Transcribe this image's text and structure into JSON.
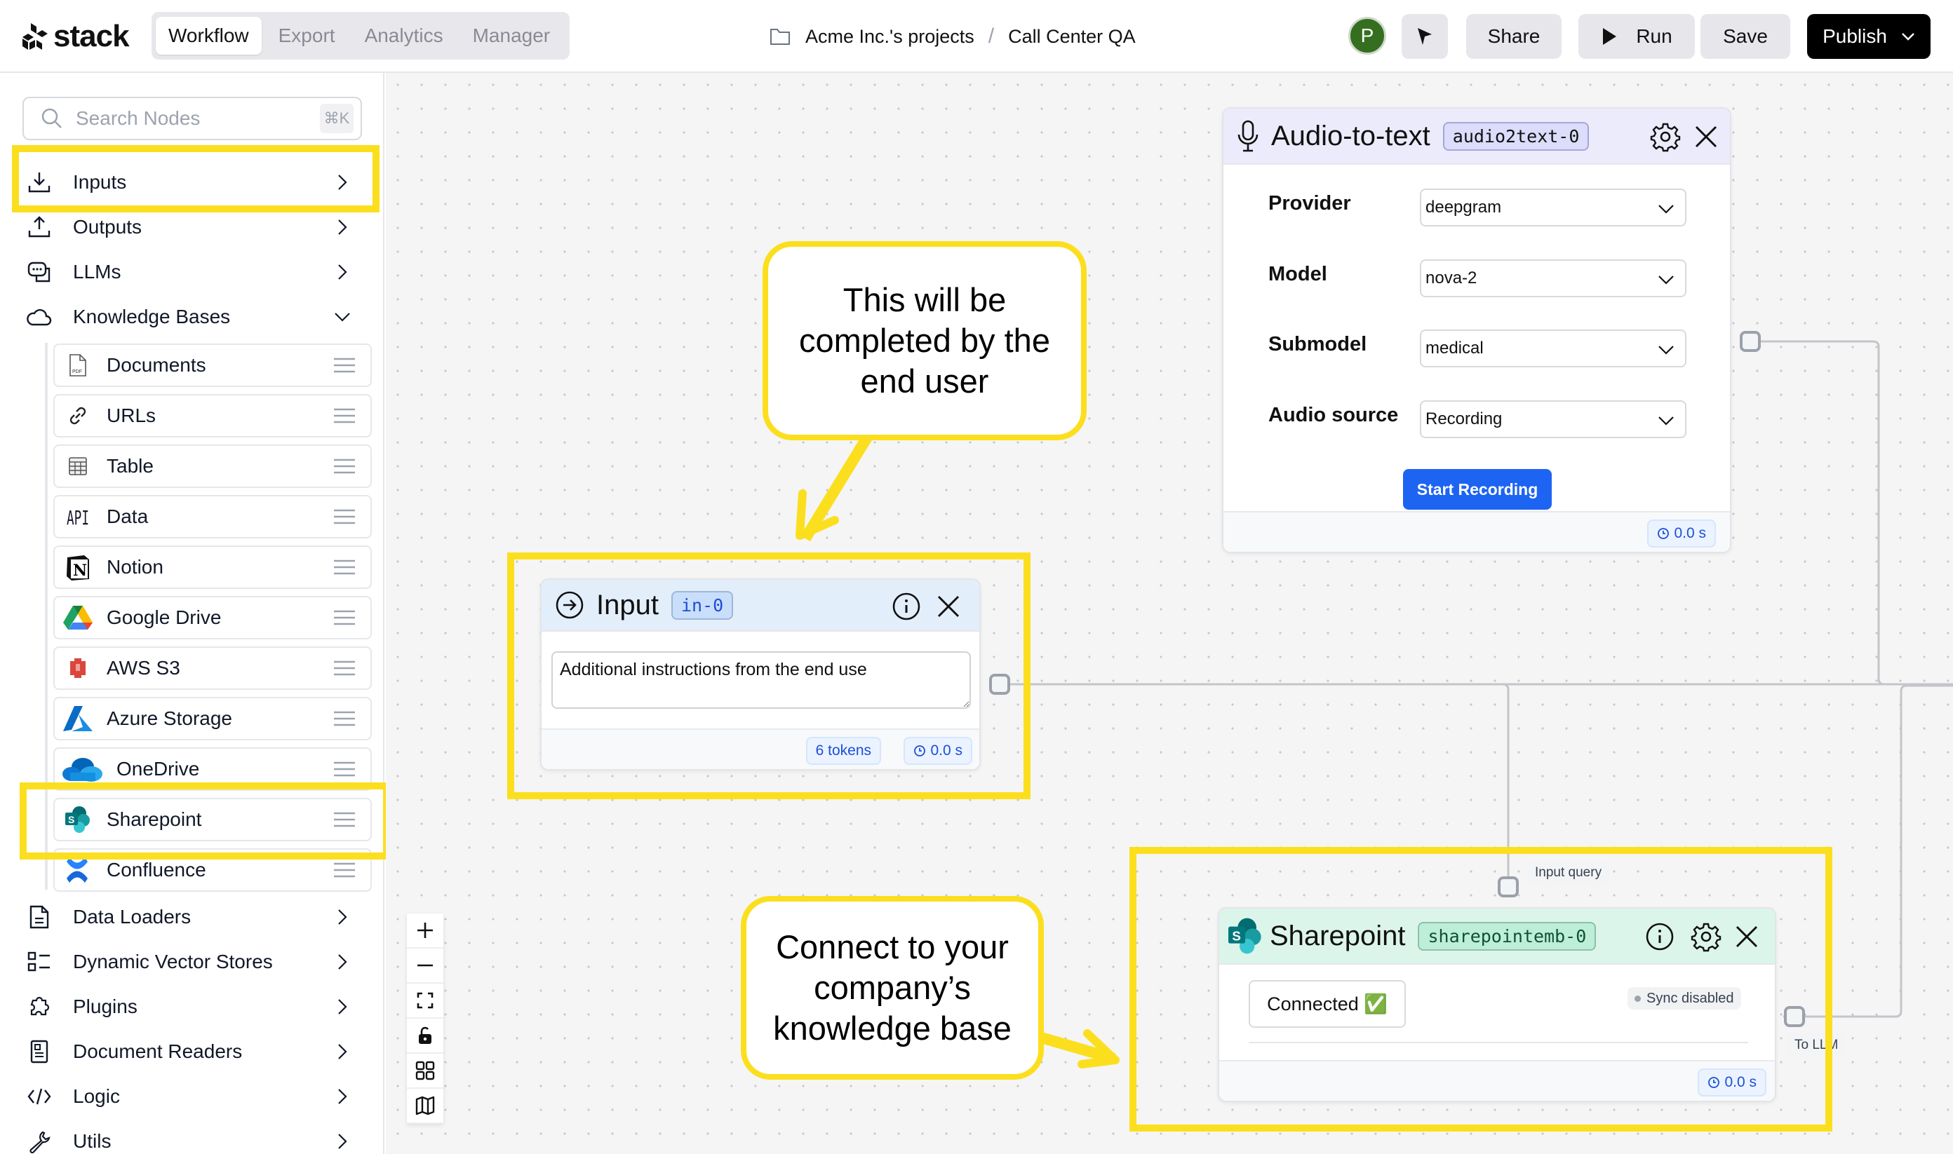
{
  "app": {
    "logo_text": "stack",
    "tabs": [
      {
        "label": "Workflow",
        "active": true
      },
      {
        "label": "Export",
        "active": false
      },
      {
        "label": "Analytics",
        "active": false
      },
      {
        "label": "Manager",
        "active": false
      }
    ],
    "breadcrumb": {
      "project": "Acme Inc.'s projects",
      "separator": "/",
      "flow": "Call Center QA"
    },
    "user_initial": "P",
    "buttons": {
      "share": "Share",
      "run": "Run",
      "save": "Save",
      "publish": "Publish"
    },
    "colors": {
      "avatar": "#356e1f",
      "highlight": "#fbdf1e",
      "primary_button": "#1d64f2"
    }
  },
  "sidebar": {
    "search_placeholder": "Search Nodes",
    "search_shortcut": "⌘K",
    "categories_top": [
      {
        "label": "Inputs",
        "icon": "download-icon",
        "expanded": false
      },
      {
        "label": "Outputs",
        "icon": "upload-icon",
        "expanded": false
      },
      {
        "label": "LLMs",
        "icon": "chat-bubbles-icon",
        "expanded": false
      },
      {
        "label": "Knowledge Bases",
        "icon": "cloud-icon",
        "expanded": true
      }
    ],
    "knowledge_bases": [
      {
        "label": "Documents",
        "icon": "pdf-file-icon"
      },
      {
        "label": "URLs",
        "icon": "link-icon"
      },
      {
        "label": "Table",
        "icon": "table-icon"
      },
      {
        "label": "Data",
        "icon": "api-icon"
      },
      {
        "label": "Notion",
        "icon": "notion-icon"
      },
      {
        "label": "Google Drive",
        "icon": "google-drive-icon"
      },
      {
        "label": "AWS S3",
        "icon": "aws-s3-icon"
      },
      {
        "label": "Azure Storage",
        "icon": "azure-icon"
      },
      {
        "label": "OneDrive",
        "icon": "onedrive-icon"
      },
      {
        "label": "Sharepoint",
        "icon": "sharepoint-icon"
      },
      {
        "label": "Confluence",
        "icon": "confluence-icon"
      }
    ],
    "categories_bottom": [
      {
        "label": "Data Loaders",
        "icon": "file-text-icon"
      },
      {
        "label": "Dynamic Vector Stores",
        "icon": "list-squares-icon"
      },
      {
        "label": "Plugins",
        "icon": "puzzle-icon"
      },
      {
        "label": "Document Readers",
        "icon": "document-reader-icon"
      },
      {
        "label": "Logic",
        "icon": "code-icon"
      },
      {
        "label": "Utils",
        "icon": "wrench-icon"
      }
    ]
  },
  "canvas": {
    "audio_node": {
      "title": "Audio-to-text",
      "id_badge": "audio2text-0",
      "fields": [
        {
          "label": "Provider",
          "value": "deepgram"
        },
        {
          "label": "Model",
          "value": "nova-2"
        },
        {
          "label": "Submodel",
          "value": "medical"
        },
        {
          "label": "Audio source",
          "value": "Recording"
        }
      ],
      "action_button": "Start Recording",
      "time": "0.0 s"
    },
    "input_node": {
      "title": "Input",
      "id_badge": "in-0",
      "text_value": "Additional instructions from the end use",
      "tokens": "6 tokens",
      "time": "0.0 s"
    },
    "sharepoint_node": {
      "title": "Sharepoint",
      "id_badge": "sharepointemb-0",
      "status": "Connected ✅",
      "sync_status": "Sync disabled",
      "input_handle_label": "Input query",
      "output_handle_label": "To LLM",
      "time": "0.0 s"
    },
    "callouts": [
      {
        "text": "This will be completed by the end user"
      },
      {
        "text": "Connect to your company’s knowledge base"
      }
    ],
    "controls": [
      "zoom-in",
      "zoom-out",
      "fit-view",
      "lock",
      "grid",
      "minimap"
    ]
  }
}
